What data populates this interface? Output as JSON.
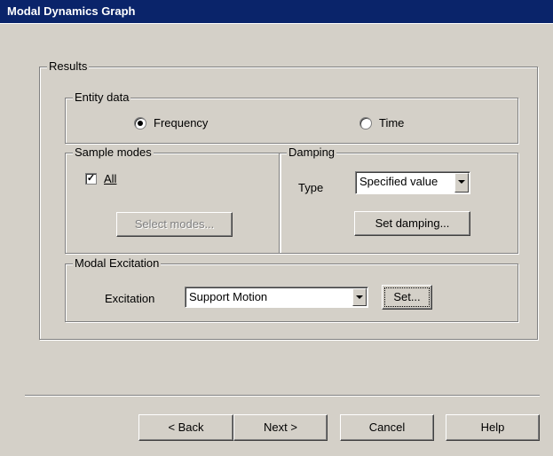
{
  "window": {
    "title": "Modal Dynamics Graph"
  },
  "results": {
    "legend": "Results",
    "entity_data": {
      "legend": "Entity data",
      "options": [
        {
          "label": "Frequency",
          "selected": true
        },
        {
          "label": "Time",
          "selected": false
        }
      ]
    },
    "sample_modes": {
      "legend": "Sample modes",
      "all_label": "All",
      "all_checked": true,
      "select_button": "Select modes..."
    },
    "damping": {
      "legend": "Damping",
      "type_label": "Type",
      "type_value": "Specified value",
      "set_button": "Set damping..."
    },
    "modal_excitation": {
      "legend": "Modal Excitation",
      "excitation_label": "Excitation",
      "excitation_value": "Support Motion",
      "set_button": "Set..."
    }
  },
  "footer": {
    "back": "< Back",
    "next": "Next >",
    "cancel": "Cancel",
    "help": "Help"
  }
}
